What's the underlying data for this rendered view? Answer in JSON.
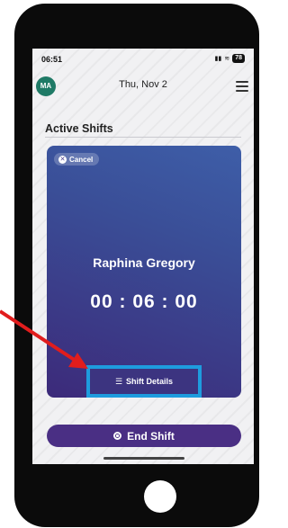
{
  "status": {
    "time": "06:51",
    "battery": "78"
  },
  "header": {
    "avatar": "MA",
    "date": "Thu, Nov 2"
  },
  "section": {
    "title": "Active Shifts"
  },
  "shift": {
    "cancel_label": "Cancel",
    "name": "Raphina Gregory",
    "timer": "00 : 06 : 00",
    "details_label": "Shift Details"
  },
  "footer": {
    "end_label": "End Shift"
  },
  "colors": {
    "accent": "#4a2f84",
    "highlight": "#1e9cde",
    "arrow": "#e11d1d"
  }
}
